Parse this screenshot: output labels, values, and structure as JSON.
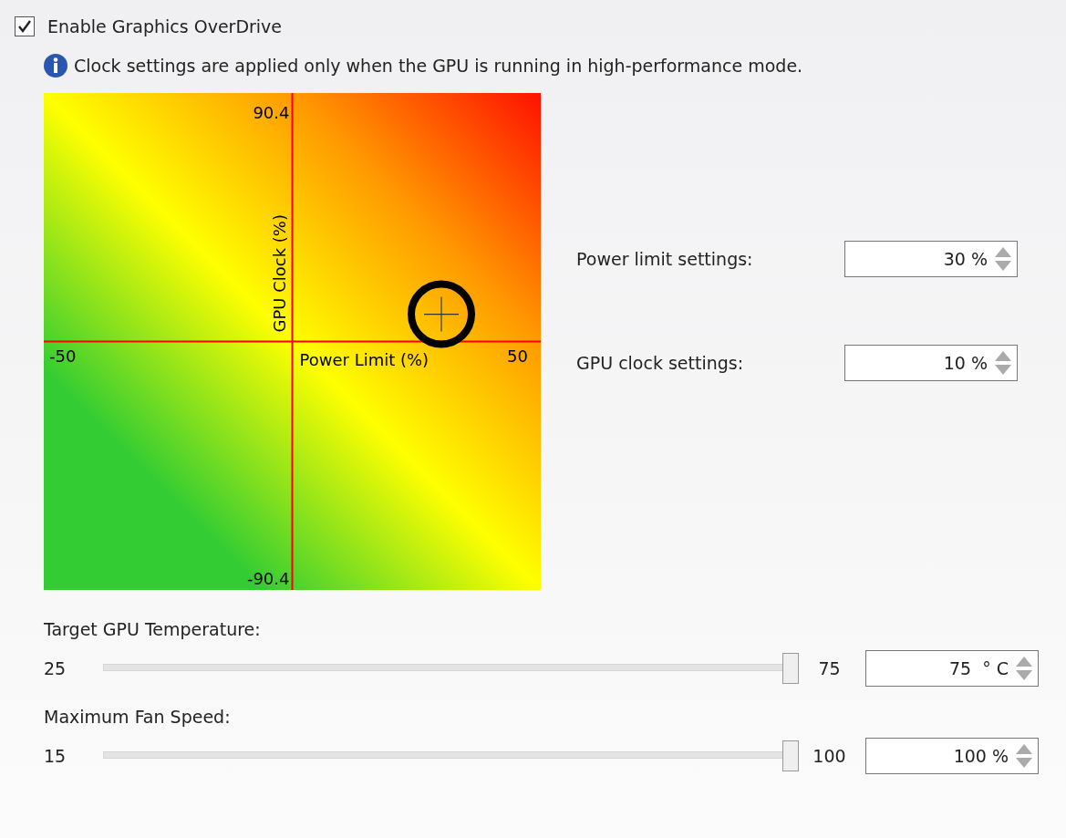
{
  "overdrive": {
    "label": "Enable Graphics OverDrive",
    "checked": true
  },
  "info": "Clock settings are applied only when the GPU is running in high-performance mode.",
  "pad": {
    "x_label": "Power Limit (%)",
    "y_label": "GPU Clock (%)",
    "x_min": "-50",
    "x_max": "50",
    "y_min": "-90.4",
    "y_max": "90.4"
  },
  "settings": [
    {
      "label": "Power limit settings:",
      "value": "30 %"
    },
    {
      "label": "GPU clock settings:",
      "value": "10 %"
    }
  ],
  "sliders": [
    {
      "title": "Target GPU Temperature:",
      "min": "25",
      "max": "75",
      "level": 1,
      "value": "75  ° C"
    },
    {
      "title": "Maximum Fan Speed:",
      "min": "15",
      "max": "100",
      "level": 1,
      "value": "100 %"
    }
  ]
}
